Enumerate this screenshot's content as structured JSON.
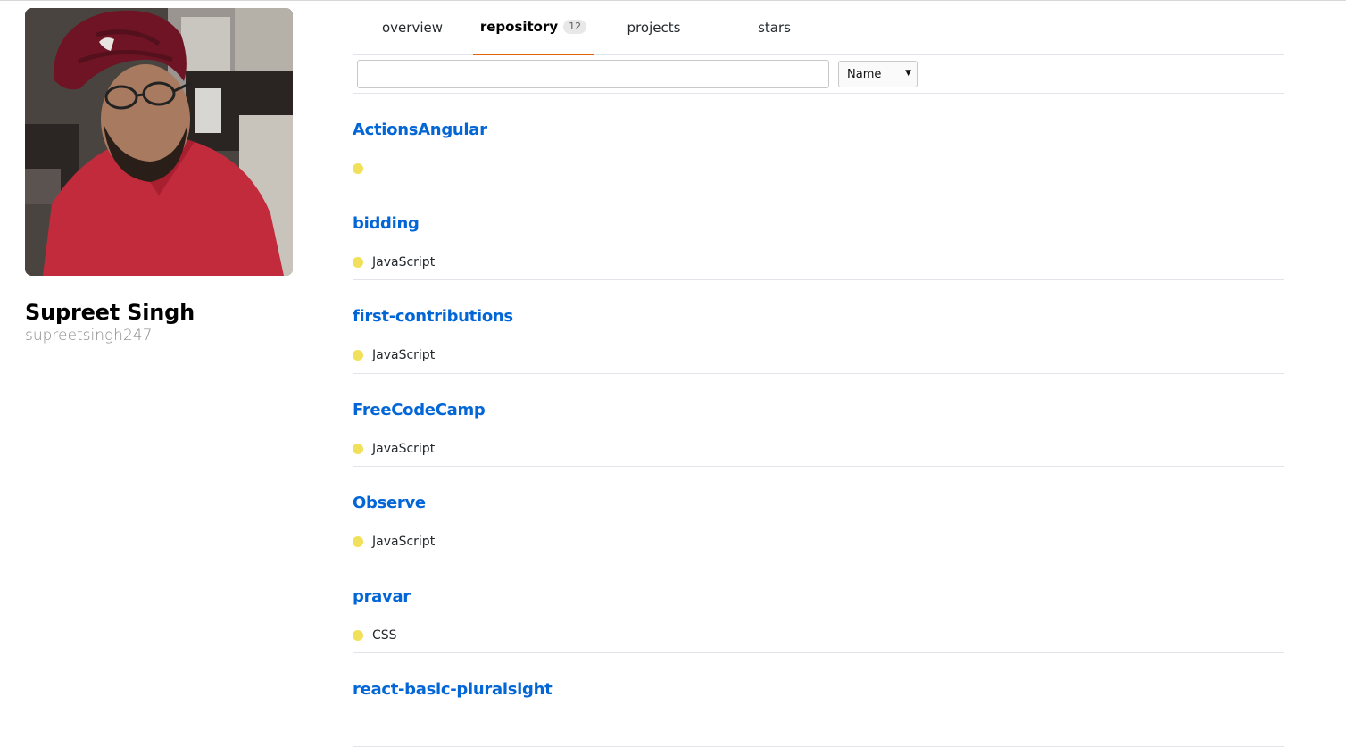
{
  "profile": {
    "name": "Supreet Singh",
    "login": "supreetsingh247"
  },
  "tabs": [
    {
      "label": "overview"
    },
    {
      "label": "repository",
      "count": "12",
      "selected": true
    },
    {
      "label": "projects"
    },
    {
      "label": "stars"
    }
  ],
  "filter": {
    "search_value": "",
    "sort_selected": "Name"
  },
  "colors": {
    "link": "#0366d6",
    "tab_underline": "#e36209",
    "language_dot": "#f1e05a"
  },
  "repositories": [
    {
      "name": "ActionsAngular",
      "language": ""
    },
    {
      "name": "bidding",
      "language": "JavaScript"
    },
    {
      "name": "first-contributions",
      "language": "JavaScript"
    },
    {
      "name": "FreeCodeCamp",
      "language": "JavaScript"
    },
    {
      "name": "Observe",
      "language": "JavaScript"
    },
    {
      "name": "pravar",
      "language": "CSS"
    },
    {
      "name": "react-basic-pluralsight",
      "language": ""
    }
  ]
}
